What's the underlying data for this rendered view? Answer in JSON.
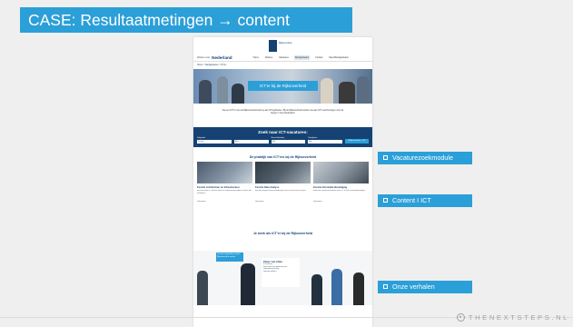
{
  "slide": {
    "title": "CASE: Resultaatmetingen → content",
    "annotations": [
      {
        "label": "Vacaturezoekmodule"
      },
      {
        "label": "Content I ICT"
      },
      {
        "label": "Onze verhalen"
      }
    ],
    "footer_brand": "THENEXTSTEPS.NL"
  },
  "website": {
    "logo_text": "Rijksoverheid",
    "brand_small": "Werken voor",
    "brand": "Nederland",
    "nav": [
      "Home",
      "Werken",
      "Vacatures",
      "Werkgebieden",
      "Contact",
      "Meer/Werkgebieden"
    ],
    "nav_active_index": 3,
    "breadcrumb": "Home > Werkgebieden > ICT'er",
    "hero_title": "ICT'er bij de Rijksoverheid",
    "intro": "Als een ICT'er van de Rijksoverheid werk je aan ICT-gebieden. Bij de Rijksoverheid werken we aan ICT-voorzieningen voor de burger in heel Nederland.",
    "search": {
      "title": "Zoek naar ICT-vacatures:",
      "fields": [
        {
          "label": "Vakgebied",
          "value": "Functie"
        },
        {
          "label": "",
          "value": "Alles"
        },
        {
          "label": "Niveau/Opleiding",
          "value": "HBO"
        },
        {
          "label": "Standplaats",
          "value": "Alle"
        }
      ],
      "button": "Bekijk vacatures - 120"
    },
    "practice_title": "De praktijk van ICT'ers bij de Rijksoverheid",
    "cards": [
      {
        "title": "Functie Architectuur en Infrastructuur",
        "text": "Een flink aantal ICT-functies binnen de Rijksoverheid hebben te maken met architectuur.",
        "link": "Lees meer >"
      },
      {
        "title": "Functie Data Analyse",
        "text": "Met data analyse kunnen beleidsmakers snel hun werk doen en goed.",
        "link": "Lees meer >"
      },
      {
        "title": "Functie Informatie Beveiliging",
        "text": "Binnen de Rijksoverheid werken onze ICT'ers aan informatiebeveiliging.",
        "link": "Lees meer >"
      }
    ],
    "work_title": "Je werk als ICT'er bij de Rijksoverheid",
    "quote": "\"Ik vind het geweldig om bij de Rijksoverheid te werken\"",
    "story": {
      "name": "Pieter van Alten",
      "role": "ICT-adviseur",
      "text": "Pieter werkt aan digitalisering en informatievoorziening.",
      "link": "Lees zijn verhaal >"
    }
  },
  "colors": {
    "accent": "#2b9fd8",
    "brand_dark": "#154273"
  }
}
